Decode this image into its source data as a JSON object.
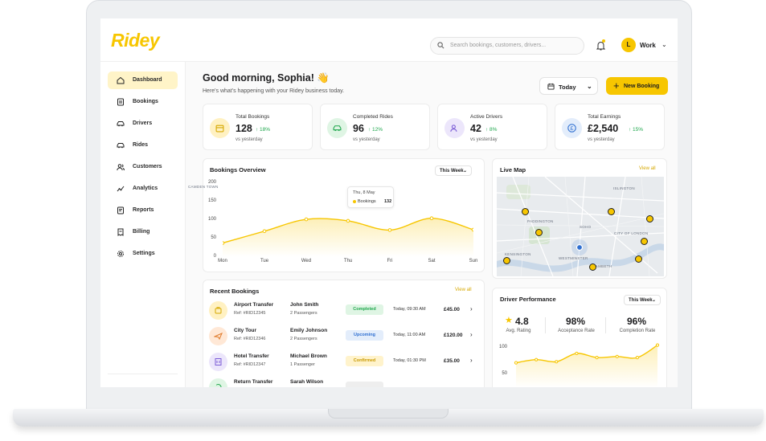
{
  "app": {
    "logo": "Ridey"
  },
  "header": {
    "search_placeholder": "Search bookings, customers, drivers...",
    "user_initial": "L",
    "user_name": "Work"
  },
  "sidebar": {
    "items": [
      {
        "label": "Dashboard",
        "icon": "home-icon"
      },
      {
        "label": "Bookings",
        "icon": "bookings-icon"
      },
      {
        "label": "Drivers",
        "icon": "car-icon"
      },
      {
        "label": "Rides",
        "icon": "car-icon"
      },
      {
        "label": "Customers",
        "icon": "users-icon"
      },
      {
        "label": "Analytics",
        "icon": "analytics-icon"
      },
      {
        "label": "Reports",
        "icon": "reports-icon"
      },
      {
        "label": "Billing",
        "icon": "billing-icon"
      },
      {
        "label": "Settings",
        "icon": "gear-icon"
      }
    ]
  },
  "page": {
    "greeting": "Good morning, Sophia! 👋",
    "subtitle": "Here's what's happening with your Ridey business today.",
    "date_filter": "Today",
    "new_booking": "New Booking"
  },
  "stats": [
    {
      "label": "Total Bookings",
      "value": "128",
      "change": "↑ 18%",
      "compare": "vs yesterday",
      "icon": "calendar-icon",
      "color": "#fff1c2"
    },
    {
      "label": "Completed Rides",
      "value": "96",
      "change": "↑ 12%",
      "compare": "vs yesterday",
      "icon": "car-icon",
      "color": "#dff5e4"
    },
    {
      "label": "Active Drivers",
      "value": "42",
      "change": "↑ 8%",
      "compare": "vs yesterday",
      "icon": "users-icon",
      "color": "#ece6fb"
    },
    {
      "label": "Total Earnings",
      "value": "£2,540",
      "change": "↑ 15%",
      "compare": "vs yesterday",
      "icon": "pound-icon",
      "color": "#e3edfb"
    }
  ],
  "bookings_overview": {
    "title": "Bookings Overview",
    "period": "This Week",
    "tooltip": {
      "date": "Thu, 8 May",
      "series": "Bookings",
      "value": "132"
    }
  },
  "chart_data": [
    {
      "type": "area",
      "title": "Bookings Overview",
      "categories": [
        "Mon",
        "Tue",
        "Wed",
        "Thu",
        "Fri",
        "Sat",
        "Sun"
      ],
      "series": [
        {
          "name": "Bookings",
          "values": [
            38,
            70,
            102,
            98,
            73,
            105,
            74
          ]
        }
      ],
      "yticks": [
        0,
        50,
        100,
        150,
        200
      ],
      "ylim": [
        0,
        200
      ],
      "grid": false
    },
    {
      "type": "area",
      "title": "Driver Performance",
      "categories": [
        "1",
        "2",
        "3",
        "4",
        "5",
        "6",
        "7",
        "8"
      ],
      "series": [
        {
          "values": [
            72,
            78,
            74,
            90,
            82,
            84,
            82,
            106
          ]
        }
      ],
      "yticks": [
        50,
        100
      ],
      "ylim": [
        25,
        110
      ],
      "grid": false
    }
  ],
  "live_map": {
    "title": "Live Map",
    "view_all": "View all",
    "labels": [
      "CAMDEN TOWN",
      "ISLINGTON",
      "PADDINGTON",
      "SOHO",
      "CITY OF LONDON",
      "KENSINGTON",
      "WESTMINSTER",
      "LAMBETH"
    ]
  },
  "recent_bookings": {
    "title": "Recent Bookings",
    "view_all": "View all",
    "rows": [
      {
        "type": "Airport Transfer",
        "ref": "Ref: #RID12345",
        "customer": "John Smith",
        "passengers": "2 Passengers",
        "status": "Completed",
        "status_bg": "#dff5e4",
        "status_fg": "#1fa74d",
        "time": "Today, 09:30 AM",
        "price": "£45.00",
        "icon": "luggage-icon",
        "icon_bg": "#fff1c2"
      },
      {
        "type": "City Tour",
        "ref": "Ref: #RID12346",
        "customer": "Emily Johnson",
        "passengers": "2 Passengers",
        "status": "Upcoming",
        "status_bg": "#e3edfb",
        "status_fg": "#2f6fd1",
        "time": "Today, 11:00 AM",
        "price": "£120.00",
        "icon": "plane-icon",
        "icon_bg": "#ffe8d6"
      },
      {
        "type": "Hotel Transfer",
        "ref": "Ref: #RID12347",
        "customer": "Michael Brown",
        "passengers": "1 Passenger",
        "status": "Confirmed",
        "status_bg": "#fff3cc",
        "status_fg": "#c99a00",
        "time": "Today, 01:30 PM",
        "price": "£35.00",
        "icon": "building-icon",
        "icon_bg": "#ece6fb"
      },
      {
        "type": "Return Transfer",
        "ref": "",
        "customer": "Sarah Wilson",
        "passengers": "",
        "status": "",
        "status_bg": "#eeeeee",
        "status_fg": "#777777",
        "time": "",
        "price": "",
        "icon": "return-icon",
        "icon_bg": "#dff5e4"
      }
    ]
  },
  "driver_performance": {
    "title": "Driver Performance",
    "period": "This Week",
    "metrics": [
      {
        "value": "4.8",
        "label": "Avg. Rating"
      },
      {
        "value": "98%",
        "label": "Acceptance Rate"
      },
      {
        "value": "96%",
        "label": "Completion Rate"
      }
    ]
  },
  "colors": {
    "accent": "#f7c600",
    "positive": "#1fa74d"
  }
}
